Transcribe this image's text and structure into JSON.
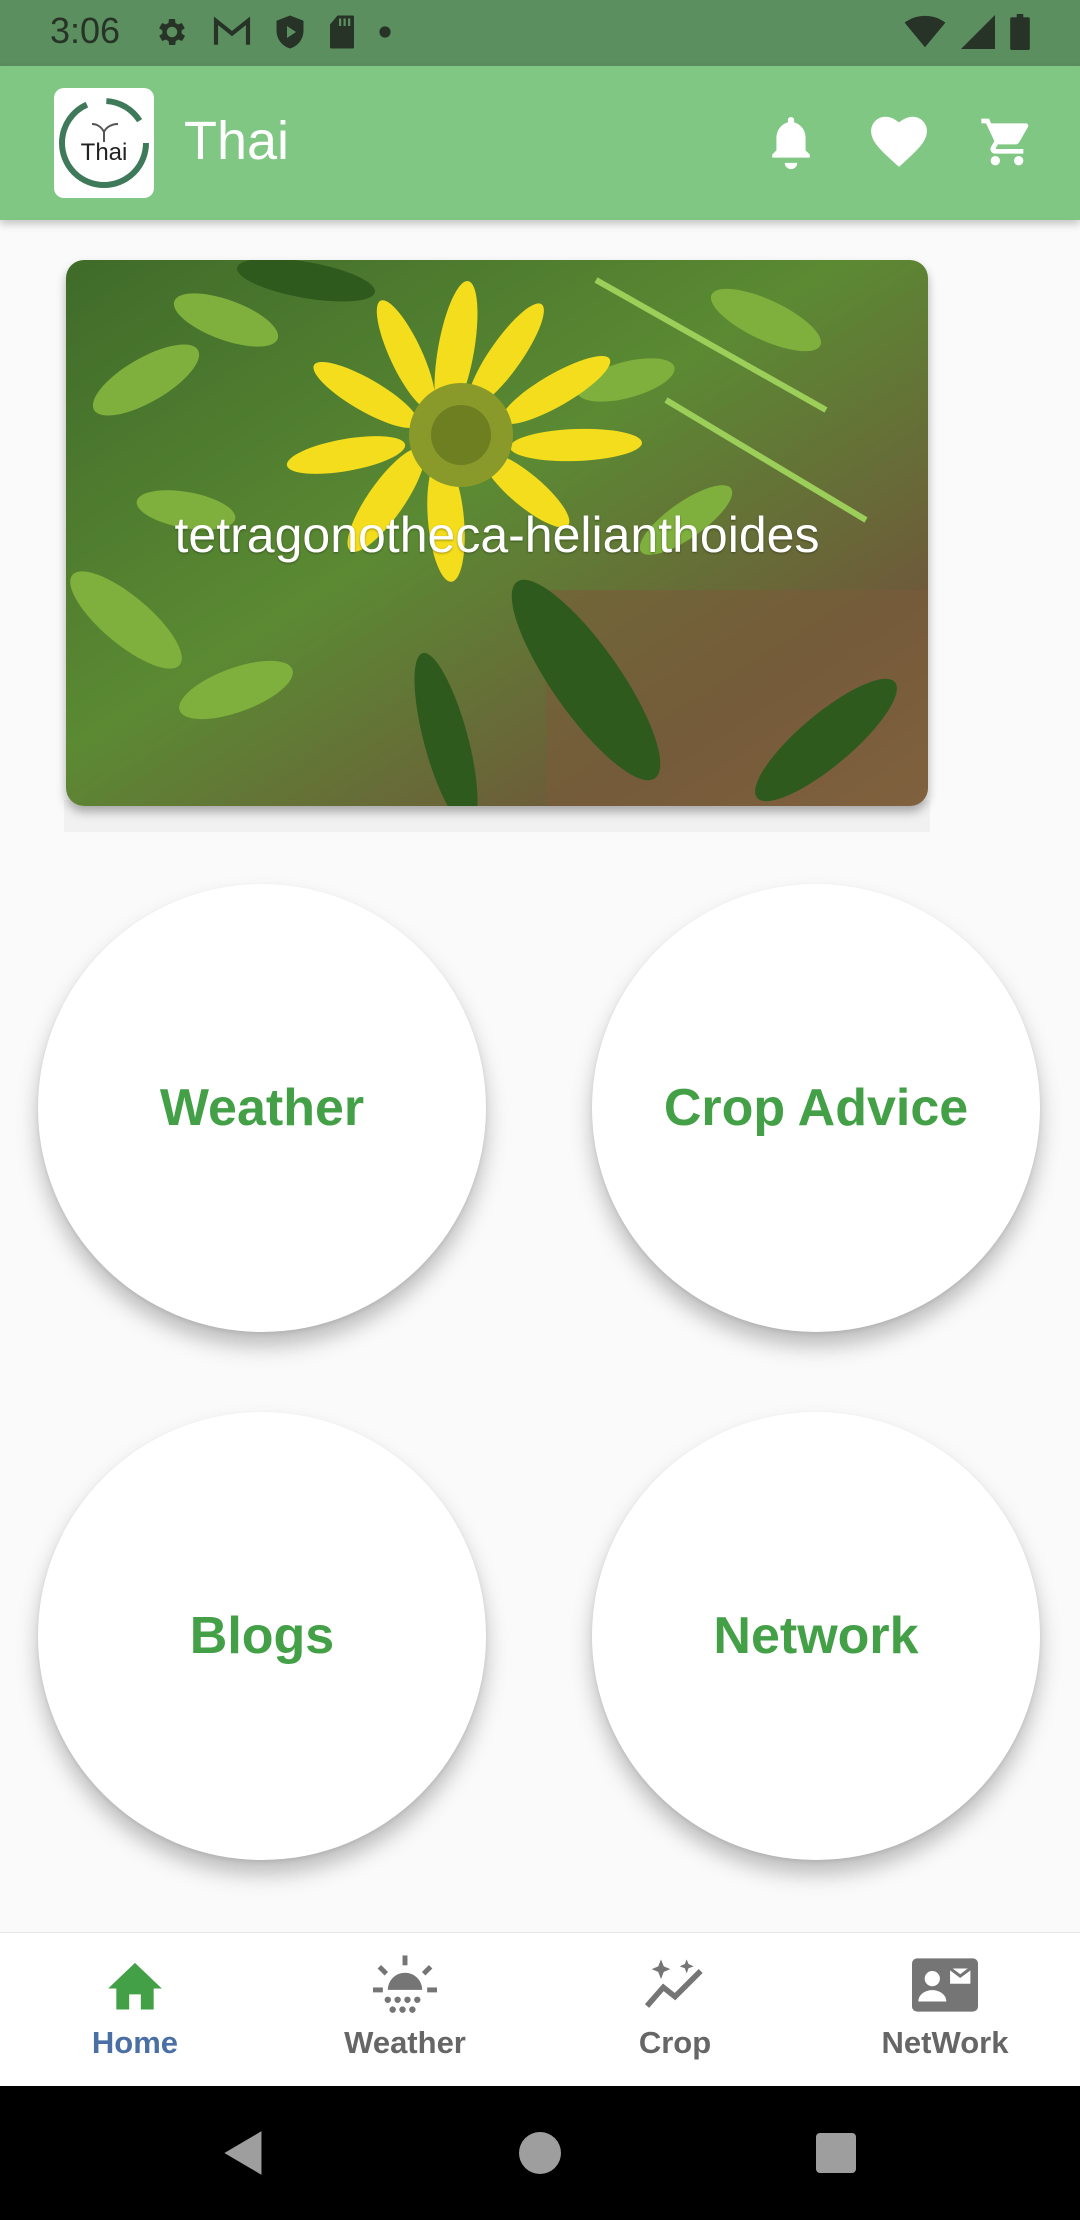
{
  "status_bar": {
    "time": "3:06",
    "icons": [
      "gear-icon",
      "gmail-icon",
      "shield-icon",
      "sd-card-icon",
      "dot-icon",
      "wifi-icon",
      "signal-icon",
      "battery-icon"
    ]
  },
  "app_bar": {
    "logo_text": "Thai",
    "title": "Thai",
    "actions": [
      "bell-icon",
      "heart-icon",
      "cart-icon"
    ],
    "color": "#81c784"
  },
  "banner": {
    "caption": "tetragonotheca-helianthoides"
  },
  "tiles": [
    {
      "label": "Weather"
    },
    {
      "label": "Crop Advice"
    },
    {
      "label": "Blogs"
    },
    {
      "label": "Network"
    }
  ],
  "tile_text_color": "#43a047",
  "bottom_nav": {
    "items": [
      {
        "label": "Home",
        "icon": "home-icon",
        "active": true
      },
      {
        "label": "Weather",
        "icon": "weather-icon",
        "active": false
      },
      {
        "label": "Crop",
        "icon": "crop-sparkle-icon",
        "active": false
      },
      {
        "label": "NetWork",
        "icon": "contact-card-icon",
        "active": false
      }
    ],
    "active_color": "#4a6fa5"
  },
  "system_nav": [
    "back-icon",
    "home-circle-icon",
    "recents-icon"
  ]
}
